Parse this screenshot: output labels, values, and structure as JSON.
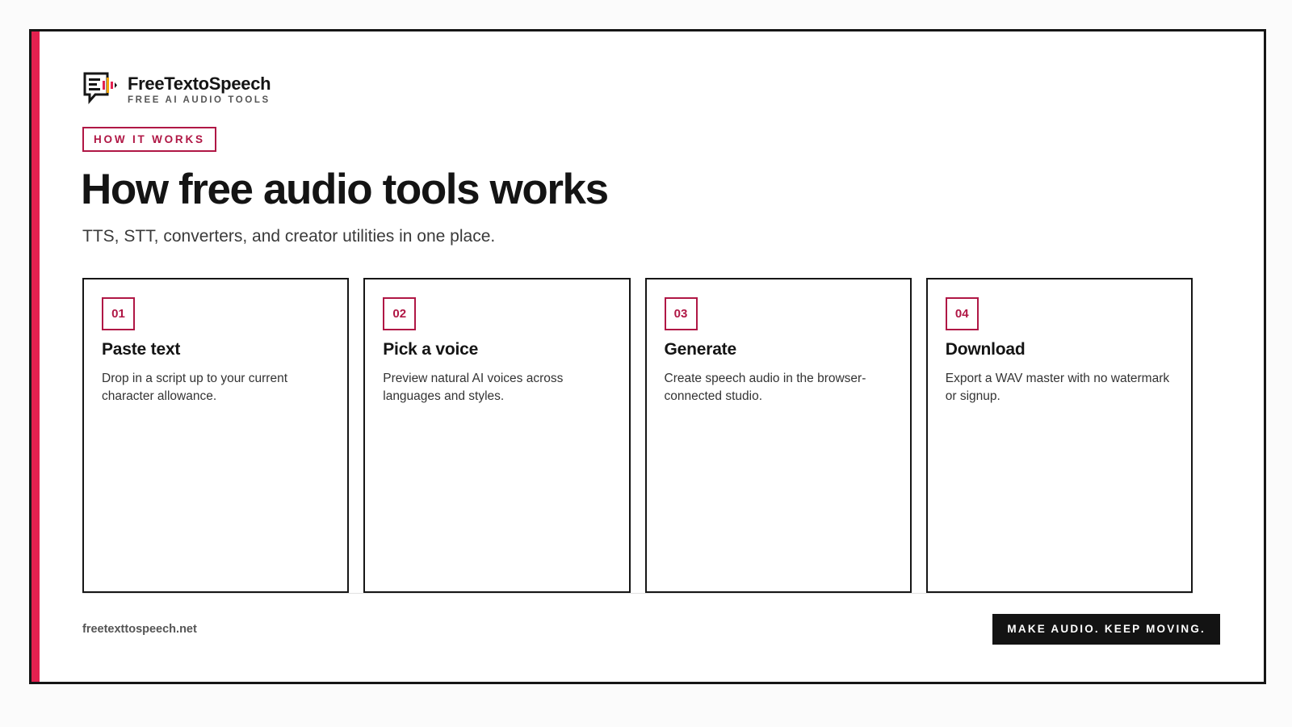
{
  "brand": {
    "name": "FreeTextoSpeech",
    "tagline": "FREE AI AUDIO TOOLS",
    "logo_icon": "speech-bubble-waveform-icon"
  },
  "kicker": "HOW IT WORKS",
  "title": "How free audio tools works",
  "subtitle": "TTS, STT, converters, and creator utilities in one place.",
  "steps": [
    {
      "number": "01",
      "title": "Paste text",
      "description": "Drop in a script up to your current character allowance."
    },
    {
      "number": "02",
      "title": "Pick a voice",
      "description": "Preview natural AI voices across languages and styles."
    },
    {
      "number": "03",
      "title": "Generate",
      "description": "Create speech audio in the browser-connected studio."
    },
    {
      "number": "04",
      "title": "Download",
      "description": "Export a WAV master with no watermark or signup."
    }
  ],
  "footer": {
    "url": "freetexttospeech.net",
    "cta": "MAKE AUDIO. KEEP MOVING."
  },
  "colors": {
    "accent_bar": "#e3214f",
    "accent_text": "#b01745",
    "border": "#161616",
    "cta_background": "#131313"
  }
}
